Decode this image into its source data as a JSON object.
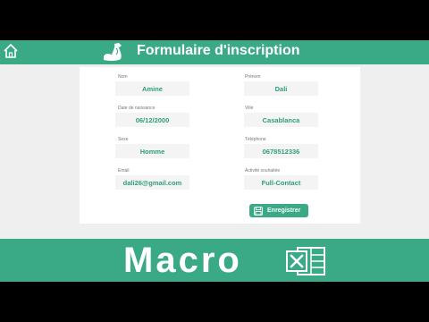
{
  "header": {
    "title": "Formulaire d'inscription"
  },
  "form": {
    "nom": {
      "label": "Nom",
      "value": "Amine"
    },
    "prenom": {
      "label": "Prénom",
      "value": "Dali"
    },
    "date_naissance": {
      "label": "Date de naissance",
      "value": "06/12/2000"
    },
    "ville": {
      "label": "Ville",
      "value": "Casablanca"
    },
    "sexe": {
      "label": "Sexe",
      "value": "Homme"
    },
    "telephone": {
      "label": "Téléphone",
      "value": "0678512336"
    },
    "email": {
      "label": "Email",
      "value": "dali26@gmail.com"
    },
    "activite": {
      "label": "Activité souhaitée",
      "value": "Full-Contact"
    },
    "save_label": "Enregistrer"
  },
  "banner": {
    "text": "Macro"
  },
  "colors": {
    "accent": "#3aa985",
    "value_text": "#2e9e7b",
    "field_bg": "#f4f4f4",
    "page_bg": "#efefef"
  },
  "icons": {
    "home": "home-icon",
    "header": "flexed-arm-icon",
    "save": "save-icon",
    "banner": "excel-icon"
  }
}
